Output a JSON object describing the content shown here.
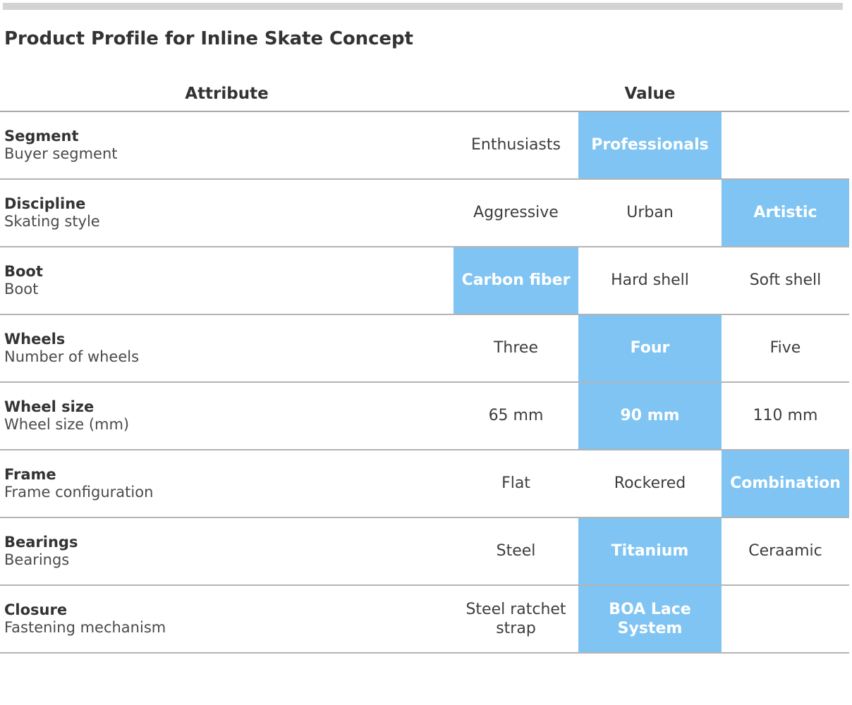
{
  "title": "Product Profile for Inline Skate Concept",
  "colors": {
    "highlight": "#7fc4f2",
    "highlight_text": "#ffffff",
    "text": "#333333",
    "rule": "#a9a9a9",
    "top_bar": "#d3d3d3"
  },
  "table": {
    "headers": {
      "attribute": "Attribute",
      "value": "Value"
    },
    "rows": [
      {
        "name": "Segment",
        "description": "Buyer segment",
        "values": [
          "Enthusiasts",
          "Professionals",
          ""
        ],
        "selected_index": 1
      },
      {
        "name": "Discipline",
        "description": "Skating style",
        "values": [
          "Aggressive",
          "Urban",
          "Artistic"
        ],
        "selected_index": 2
      },
      {
        "name": "Boot",
        "description": "Boot",
        "values": [
          "Carbon fiber",
          "Hard shell",
          "Soft shell"
        ],
        "selected_index": 0
      },
      {
        "name": "Wheels",
        "description": "Number of wheels",
        "values": [
          "Three",
          "Four",
          "Five"
        ],
        "selected_index": 1
      },
      {
        "name": "Wheel size",
        "description": "Wheel size (mm)",
        "values": [
          "65 mm",
          "90 mm",
          "110 mm"
        ],
        "selected_index": 1
      },
      {
        "name": "Frame",
        "description": "Frame configuration",
        "values": [
          "Flat",
          "Rockered",
          "Combination"
        ],
        "selected_index": 2
      },
      {
        "name": "Bearings",
        "description": "Bearings",
        "values": [
          "Steel",
          "Titanium",
          "Ceraamic"
        ],
        "selected_index": 1
      },
      {
        "name": "Closure",
        "description": "Fastening mechanism",
        "values": [
          "Steel ratchet strap",
          "BOA Lace System",
          ""
        ],
        "selected_index": 1
      }
    ]
  }
}
